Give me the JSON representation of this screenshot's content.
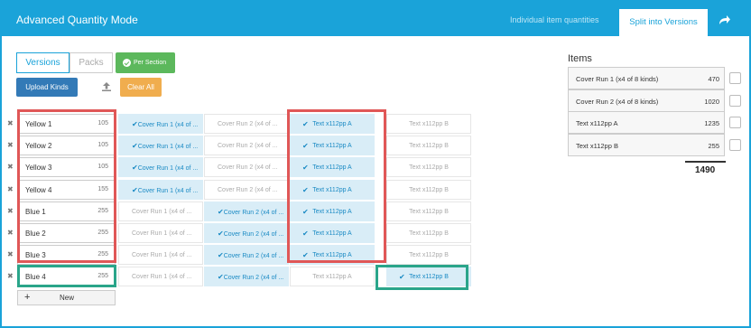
{
  "header": {
    "title": "Advanced Quantity Mode",
    "tabs": [
      "Individual item quantities",
      "Split into Versions"
    ],
    "active_tab": "Split into Versions",
    "share_icon": "share-arrow-icon",
    "color": "#1aa3d9"
  },
  "toolbar": {
    "versions_label": "Versions",
    "packs_label": "Packs",
    "per_section_label": "Per Section",
    "upload_label": "Upload Kinds",
    "clear_label": "Clear All",
    "new_label": "New"
  },
  "grid": {
    "rows": [
      {
        "name": "Yellow 1",
        "qty": "105",
        "cells": [
          "Cover Run 1 (x4 of ...",
          "Cover Run 2 (x4 of ...",
          "Text x112pp A",
          "Text x112pp B"
        ],
        "sel": [
          true,
          false,
          true,
          false
        ]
      },
      {
        "name": "Yellow 2",
        "qty": "105",
        "cells": [
          "Cover Run 1 (x4 of ...",
          "Cover Run 2 (x4 of ...",
          "Text x112pp A",
          "Text x112pp B"
        ],
        "sel": [
          true,
          false,
          true,
          false
        ]
      },
      {
        "name": "Yellow 3",
        "qty": "105",
        "cells": [
          "Cover Run 1 (x4 of ...",
          "Cover Run 2 (x4 of ...",
          "Text x112pp A",
          "Text x112pp B"
        ],
        "sel": [
          true,
          false,
          true,
          false
        ]
      },
      {
        "name": "Yellow 4",
        "qty": "155",
        "cells": [
          "Cover Run 1 (x4 of ...",
          "Cover Run 2 (x4 of ...",
          "Text x112pp A",
          "Text x112pp B"
        ],
        "sel": [
          true,
          false,
          true,
          false
        ]
      },
      {
        "name": "Blue 1",
        "qty": "255",
        "cells": [
          "Cover Run 1 (x4 of ...",
          "Cover Run 2 (x4 of ...",
          "Text x112pp A",
          "Text x112pp B"
        ],
        "sel": [
          false,
          true,
          true,
          false
        ]
      },
      {
        "name": "Blue 2",
        "qty": "255",
        "cells": [
          "Cover Run 1 (x4 of ...",
          "Cover Run 2 (x4 of ...",
          "Text x112pp A",
          "Text x112pp B"
        ],
        "sel": [
          false,
          true,
          true,
          false
        ]
      },
      {
        "name": "Blue 3",
        "qty": "255",
        "cells": [
          "Cover Run 1 (x4 of ...",
          "Cover Run 2 (x4 of ...",
          "Text x112pp A",
          "Text x112pp B"
        ],
        "sel": [
          false,
          true,
          true,
          false
        ]
      },
      {
        "name": "Blue 4",
        "qty": "255",
        "cells": [
          "Cover Run 1 (x4 of ...",
          "Cover Run 2 (x4 of ...",
          "Text x112pp A",
          "Text x112pp B"
        ],
        "sel": [
          false,
          true,
          false,
          true
        ]
      }
    ]
  },
  "items": {
    "title": "Items",
    "list": [
      {
        "name": "Cover Run 1 (x4 of 8 kinds)",
        "value": "470"
      },
      {
        "name": "Cover Run 2 (x4 of 8 kinds)",
        "value": "1020"
      },
      {
        "name": "Text x112pp A",
        "value": "1235"
      },
      {
        "name": "Text x112pp B",
        "value": "255"
      }
    ],
    "total": "1490"
  },
  "colors": {
    "accent": "#1aa3d9",
    "selected_cell": "#d9edf7",
    "highlight_red": "#e05757",
    "highlight_green": "#2aa58a",
    "per_section_green": "#5cb85c",
    "upload_blue": "#337ab7",
    "clear_orange": "#f0ad4e"
  }
}
